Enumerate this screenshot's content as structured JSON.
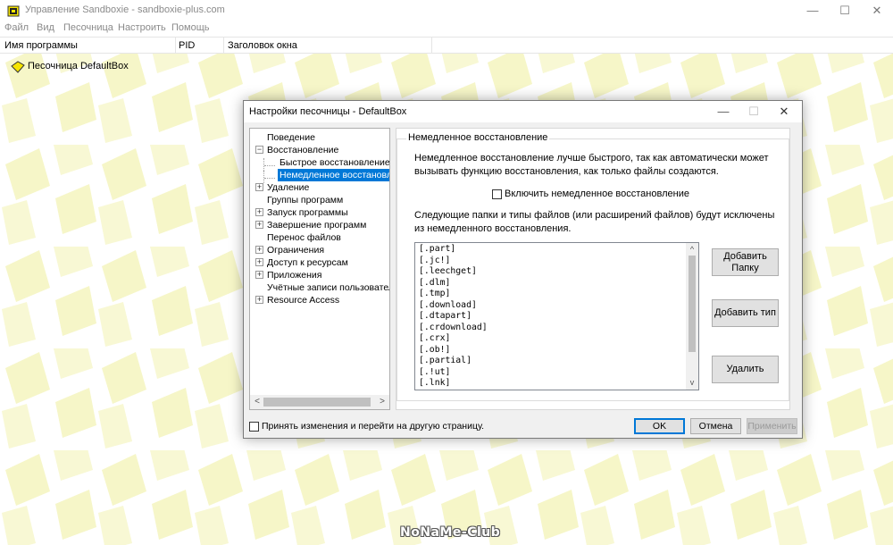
{
  "app": {
    "title": "Управление Sandboxie - sandboxie-plus.com",
    "icon": "sandboxie-app-icon",
    "window_buttons": {
      "minimize": "—",
      "maximize": "☐",
      "close": "✕"
    }
  },
  "menu": [
    "Файл",
    "Вид",
    "Песочница",
    "Настроить",
    "Помощь"
  ],
  "columns": [
    "Имя программы",
    "PID",
    "Заголовок окна"
  ],
  "sandboxes": [
    {
      "label": "Песочница DefaultBox",
      "icon": "sandbox-yellow-icon"
    }
  ],
  "watermark": "NoNaMe-Club",
  "dialog": {
    "title": "Настройки песочницы - DefaultBox",
    "buttons": {
      "minimize": "—",
      "maximize": "☐",
      "close": "✕"
    },
    "nav": [
      {
        "label": "Поведение",
        "level": 0,
        "expander": ""
      },
      {
        "label": "Восстановление",
        "level": 0,
        "expander": "−"
      },
      {
        "label": "Быстрое восстановление",
        "level": 1,
        "expander": ""
      },
      {
        "label": "Немедленное восстановление",
        "level": 1,
        "expander": "",
        "selected": true
      },
      {
        "label": "Удаление",
        "level": 0,
        "expander": "+"
      },
      {
        "label": "Группы программ",
        "level": 0,
        "expander": ""
      },
      {
        "label": "Запуск программы",
        "level": 0,
        "expander": "+"
      },
      {
        "label": "Завершение программ",
        "level": 0,
        "expander": "+"
      },
      {
        "label": "Перенос файлов",
        "level": 0,
        "expander": ""
      },
      {
        "label": "Ограничения",
        "level": 0,
        "expander": "+"
      },
      {
        "label": "Доступ к ресурсам",
        "level": 0,
        "expander": "+"
      },
      {
        "label": "Приложения",
        "level": 0,
        "expander": "+"
      },
      {
        "label": "Учётные записи пользователей",
        "level": 0,
        "expander": ""
      },
      {
        "label": "Resource Access",
        "level": 0,
        "expander": "+"
      }
    ],
    "scroll_arrows": {
      "left": "<",
      "right": ">",
      "up": "^",
      "down": "v"
    },
    "panel": {
      "group_title": "Немедленное восстановление",
      "description": "Немедленное восстановление лучше быстрого, так как автоматически может вызывать функцию восстановления, как только файлы создаются.",
      "checkbox_label": "Включить немедленное восстановление",
      "checkbox_checked": false,
      "exclusion_text": "Следующие папки и типы файлов (или расширений файлов) будут исключены из немедленного восстановления.",
      "files": [
        "[.part]",
        "[.jc!]",
        "[.leechget]",
        "[.dlm]",
        "[.tmp]",
        "[.download]",
        "[.dtapart]",
        "[.crdownload]",
        "[.crx]",
        "[.ob!]",
        "[.partial]",
        "[.!ut]",
        "[.lnk]"
      ],
      "buttons": {
        "add_folder": "Добавить Папку",
        "add_type": "Добавить тип",
        "remove": "Удалить"
      }
    },
    "footer": {
      "checkbox_label": "Принять изменения и перейти на другую страницу.",
      "checkbox_checked": false,
      "ok": "OK",
      "cancel": "Отмена",
      "apply": "Применить"
    }
  },
  "colors": {
    "accent": "#0078d7",
    "background_pattern": "#f6f6c8",
    "sandbox_icon": "#f5e400"
  }
}
